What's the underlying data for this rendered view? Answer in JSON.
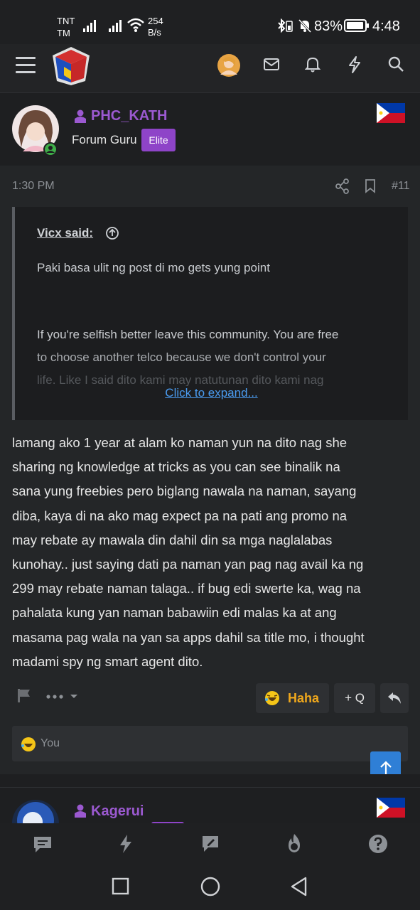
{
  "status_bar": {
    "carrier1": "TNT",
    "carrier2": "TM",
    "net_speed_value": "254",
    "net_speed_unit": "B/s",
    "battery": "83%",
    "time": "4:48"
  },
  "post": {
    "username": "PHC_KATH",
    "user_title": "Forum Guru",
    "badge": "Elite",
    "time": "1:30 PM",
    "post_number": "#11",
    "quote": {
      "author": "Vicx said:",
      "line1": "Paki basa ulit ng post di mo gets yung point",
      "para2_line1": "If you're selfish better leave this community. You are free",
      "para2_line2": "to choose another telco because we don't control your",
      "para2_line3": "life. Like I said dito kami may natutunan dito kami nag",
      "expand": "Click to expand..."
    },
    "body_lines": [
      "lamang ako 1 year at alam ko naman yun na dito nag she",
      "sharing ng knowledge at tricks as you can see binalik na",
      "sana yung freebies pero biglang nawala na naman, sayang",
      "diba, kaya di na ako mag expect pa na pati ang promo na",
      "may rebate ay mawala din dahil din sa mga naglalabas",
      "kunohay.. just saying dati pa naman yan pag nag avail ka ng",
      "299 may rebate naman talaga.. if bug edi swerte ka, wag na",
      "pahalata kung yan naman babawiin edi malas ka at ang",
      "masama pag wala na yan sa apps dahil sa title mo, i thought",
      "madami spy ng smart agent dito."
    ],
    "reaction_label": "Haha",
    "quote_button": "+ Q",
    "reactions_bar_text": "You"
  },
  "next_post": {
    "username": "Kagerui"
  },
  "colors": {
    "accent_purple": "#9b59d0",
    "badge_purple": "#8e44c8",
    "link_blue": "#4a9bef",
    "scroll_blue": "#2f7fd6",
    "reaction_orange": "#f0a81c"
  }
}
